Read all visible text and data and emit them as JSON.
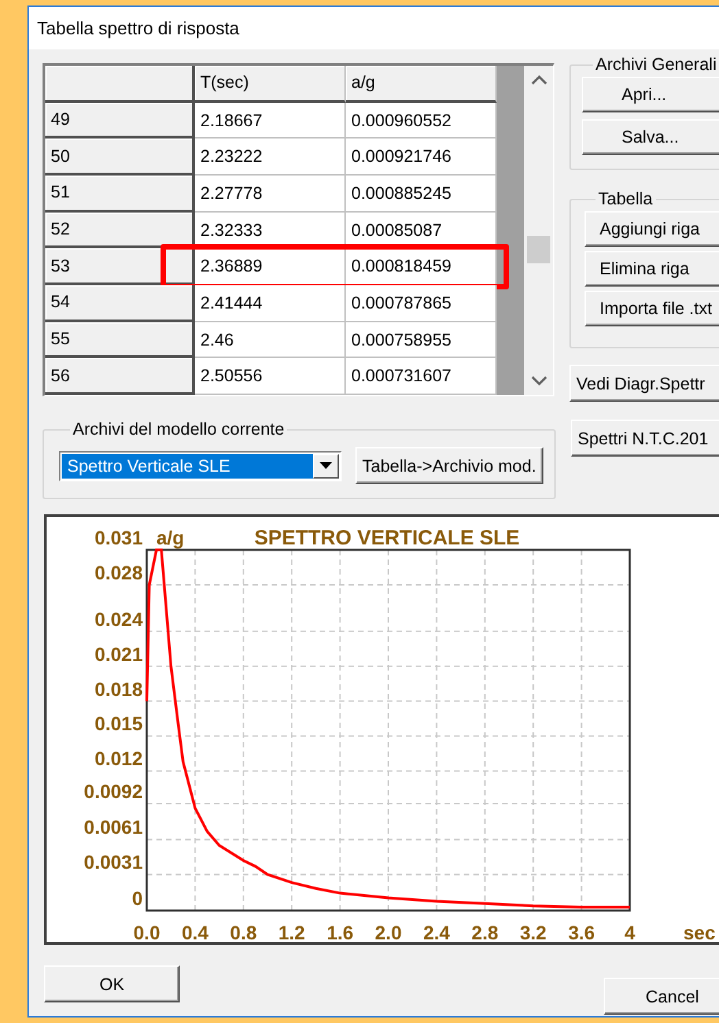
{
  "window": {
    "title": "Tabella spettro di risposta"
  },
  "table": {
    "columns": [
      "T(sec)",
      "a/g"
    ],
    "rows": [
      {
        "index": "49",
        "t_sec": "2.18667",
        "a_g": "0.000960552",
        "highlighted": false
      },
      {
        "index": "50",
        "t_sec": "2.23222",
        "a_g": "0.000921746",
        "highlighted": false
      },
      {
        "index": "51",
        "t_sec": "2.27778",
        "a_g": "0.000885245",
        "highlighted": false
      },
      {
        "index": "52",
        "t_sec": "2.32333",
        "a_g": "0.00085087",
        "highlighted": false
      },
      {
        "index": "53",
        "t_sec": "2.36889",
        "a_g": "0.000818459",
        "highlighted": true
      },
      {
        "index": "54",
        "t_sec": "2.41444",
        "a_g": "0.000787865",
        "highlighted": false
      },
      {
        "index": "55",
        "t_sec": "2.46",
        "a_g": "0.000758955",
        "highlighted": false
      },
      {
        "index": "56",
        "t_sec": "2.50556",
        "a_g": "0.000731607",
        "highlighted": false
      }
    ]
  },
  "archivi_generali": {
    "title": "Archivi Generali",
    "buttons": [
      "Apri...",
      "Salva..."
    ]
  },
  "tabella": {
    "title": "Tabella",
    "buttons": [
      "Aggiungi riga",
      "Elimina riga",
      "Importa file .txt"
    ]
  },
  "diagram_button": "Vedi Diagr.Spettr",
  "modello_corrente": {
    "title": "Archivi del modello corrente",
    "dropdown": {
      "value": "Spettro Verticale SLE"
    },
    "button": "Tabella->Archivio mod."
  },
  "ntc_button": "Spettri N.T.C.201",
  "chart": {
    "chart_data": {
      "type": "line",
      "grid": true,
      "title": "SPETTRO VERTICALE SLE",
      "xlabel": "sec",
      "ylabel": "a/g",
      "xlim": [
        0,
        4
      ],
      "ylim": [
        0,
        0.031
      ],
      "x": [
        0,
        0.02,
        0.08,
        0.12,
        0.2,
        0.26,
        0.3,
        0.4,
        0.5,
        0.6,
        0.8,
        0.9,
        1.0,
        1.2,
        1.4,
        1.6,
        2.0,
        2.4,
        2.8,
        3.2,
        3.6,
        4.0
      ],
      "series": [
        {
          "color": "#ff0000",
          "values": [
            0.018,
            0.028,
            0.031,
            0.031,
            0.021,
            0.016,
            0.0128,
            0.0088,
            0.0068,
            0.0056,
            0.0043,
            0.0038,
            0.0031,
            0.0024,
            0.0019,
            0.0015,
            0.0011,
            0.0008,
            0.0006,
            0.0004,
            0.0003,
            0.0003
          ]
        }
      ],
      "xticks": [
        {
          "value": 0,
          "label": "0.0"
        },
        {
          "value": 0.4,
          "label": "0.4"
        },
        {
          "value": 0.8,
          "label": "0.8"
        },
        {
          "value": 1.2,
          "label": "1.2"
        },
        {
          "value": 1.6,
          "label": "1.6"
        },
        {
          "value": 2.0,
          "label": "2.0"
        },
        {
          "value": 2.4,
          "label": "2.4"
        },
        {
          "value": 2.8,
          "label": "2.8"
        },
        {
          "value": 3.2,
          "label": "3.2"
        },
        {
          "value": 3.6,
          "label": "3.6"
        },
        {
          "value": 4,
          "label": "4"
        }
      ],
      "yticks": [
        {
          "value": 0,
          "label": "0"
        },
        {
          "value": 0.0031,
          "label": "0.0031"
        },
        {
          "value": 0.0061,
          "label": "0.0061"
        },
        {
          "value": 0.0092,
          "label": "0.0092"
        },
        {
          "value": 0.012,
          "label": "0.012"
        },
        {
          "value": 0.015,
          "label": "0.015"
        },
        {
          "value": 0.018,
          "label": "0.018"
        },
        {
          "value": 0.021,
          "label": "0.021"
        },
        {
          "value": 0.024,
          "label": "0.024"
        },
        {
          "value": 0.028,
          "label": "0.028"
        },
        {
          "value": 0.031,
          "label": "0.031"
        }
      ]
    }
  },
  "buttons": [
    "OK",
    "Cancel"
  ]
}
